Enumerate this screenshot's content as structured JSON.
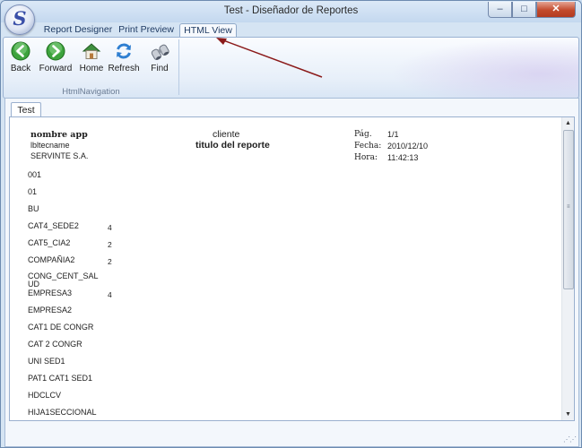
{
  "window": {
    "title": "Test - Diseñador de Reportes",
    "app_letter": "S",
    "buttons": {
      "minimize": "–",
      "maximize": "□",
      "close": "✕"
    }
  },
  "ribbon_tabs": [
    "Report Designer",
    "Print Preview",
    "HTML View"
  ],
  "ribbon": {
    "buttons": [
      {
        "label": "Back",
        "icon": "back-arrow-icon"
      },
      {
        "label": "Forward",
        "icon": "forward-arrow-icon"
      },
      {
        "label": "Home",
        "icon": "home-icon"
      },
      {
        "label": "Refresh",
        "icon": "refresh-icon"
      },
      {
        "label": "Find",
        "icon": "binoculars-icon"
      }
    ],
    "group_label": "HtmlNavigation"
  },
  "document_tab": "Test",
  "report": {
    "app_name": "nombre app",
    "lbl_tecname": "lbltecname",
    "company": "SERVINTE  S.A.",
    "client": "cliente",
    "report_title": "titulo del reporte",
    "page_label": "Pág.",
    "page_value": "1/1",
    "date_label": "Fecha:",
    "date_value": "2010/12/10",
    "time_label": "Hora:",
    "time_value": "11:42:13",
    "rows": [
      {
        "name": "001",
        "value": ""
      },
      {
        "name": "01",
        "value": ""
      },
      {
        "name": "BU",
        "value": ""
      },
      {
        "name": "CAT4_SEDE2",
        "value": "4"
      },
      {
        "name": "CAT5_CIA2",
        "value": "2"
      },
      {
        "name": "COMPAÑIA2",
        "value": "2"
      },
      {
        "name": "CONG_CENT_SAL",
        "name2": "UD",
        "value": ""
      },
      {
        "name": "EMPRESA3",
        "value": "4"
      },
      {
        "name": "EMPRESA2",
        "value": ""
      },
      {
        "name": "CAT1 DE CONGR",
        "value": ""
      },
      {
        "name": "CAT 2  CONGR",
        "value": ""
      },
      {
        "name": "UNI SED1",
        "value": ""
      },
      {
        "name": "PAT1 CAT1 SED1",
        "value": ""
      },
      {
        "name": "HDCLCV",
        "value": ""
      },
      {
        "name": "HIJA1SECCIONAL",
        "value": ""
      }
    ]
  },
  "colors": {
    "annotation_arrow": "#8b1a1a",
    "accent": "#1f3b63"
  }
}
